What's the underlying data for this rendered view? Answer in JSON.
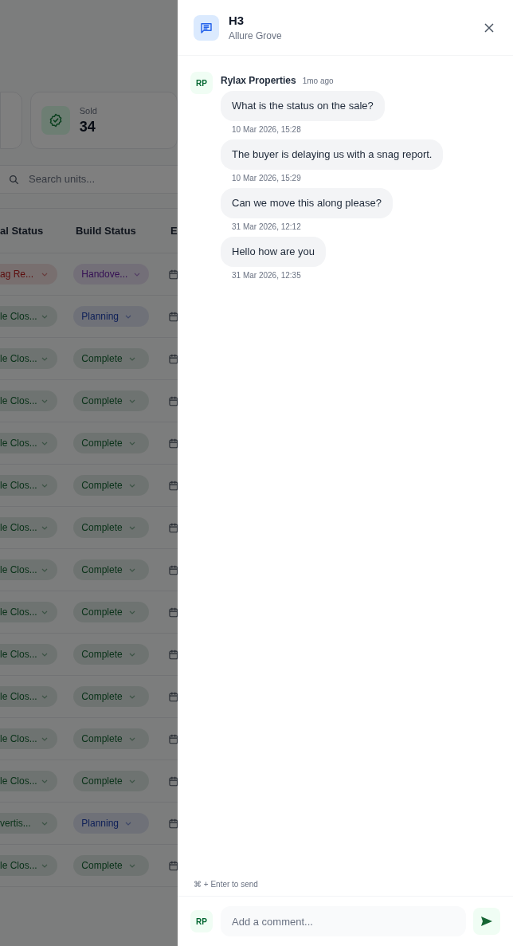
{
  "background": {
    "stat_card": {
      "label": "Sold",
      "value": "34"
    },
    "search": {
      "placeholder": "Search units..."
    },
    "table": {
      "columns": [
        "al Status",
        "Build Status",
        "E"
      ],
      "rows": [
        {
          "sales_status": {
            "text": "ag Re...",
            "kind": "red"
          },
          "build_status": {
            "text": "Handove...",
            "kind": "purple"
          }
        },
        {
          "sales_status": {
            "text": "le Clos...",
            "kind": "green"
          },
          "build_status": {
            "text": "Planning",
            "kind": "blue"
          }
        },
        {
          "sales_status": {
            "text": "le Clos...",
            "kind": "green"
          },
          "build_status": {
            "text": "Complete",
            "kind": "green"
          }
        },
        {
          "sales_status": {
            "text": "le Clos...",
            "kind": "green"
          },
          "build_status": {
            "text": "Complete",
            "kind": "green"
          }
        },
        {
          "sales_status": {
            "text": "le Clos...",
            "kind": "green"
          },
          "build_status": {
            "text": "Complete",
            "kind": "green"
          }
        },
        {
          "sales_status": {
            "text": "le Clos...",
            "kind": "green"
          },
          "build_status": {
            "text": "Complete",
            "kind": "green"
          }
        },
        {
          "sales_status": {
            "text": "le Clos...",
            "kind": "green"
          },
          "build_status": {
            "text": "Complete",
            "kind": "green"
          }
        },
        {
          "sales_status": {
            "text": "le Clos...",
            "kind": "green"
          },
          "build_status": {
            "text": "Complete",
            "kind": "green"
          }
        },
        {
          "sales_status": {
            "text": "le Clos...",
            "kind": "green"
          },
          "build_status": {
            "text": "Complete",
            "kind": "green"
          }
        },
        {
          "sales_status": {
            "text": "le Clos...",
            "kind": "green"
          },
          "build_status": {
            "text": "Complete",
            "kind": "green"
          }
        },
        {
          "sales_status": {
            "text": "le Clos...",
            "kind": "green"
          },
          "build_status": {
            "text": "Complete",
            "kind": "green"
          }
        },
        {
          "sales_status": {
            "text": "le Clos...",
            "kind": "green"
          },
          "build_status": {
            "text": "Complete",
            "kind": "green"
          }
        },
        {
          "sales_status": {
            "text": "le Clos...",
            "kind": "green"
          },
          "build_status": {
            "text": "Complete",
            "kind": "green"
          }
        },
        {
          "sales_status": {
            "text": "vertis...",
            "kind": "green"
          },
          "build_status": {
            "text": "Planning",
            "kind": "blue"
          }
        },
        {
          "sales_status": {
            "text": "le Clos...",
            "kind": "green"
          },
          "build_status": {
            "text": "Complete",
            "kind": "green"
          }
        }
      ]
    }
  },
  "panel": {
    "title": "H3",
    "subtitle": "Allure Grove",
    "thread": {
      "initials": "RP",
      "author": "Rylax Properties",
      "time_ago": "1mo ago",
      "messages": [
        {
          "text": "What is the status on the sale?",
          "timestamp": "10 Mar 2026, 15:28"
        },
        {
          "text": "The buyer is delaying us with a snag report.",
          "timestamp": "10 Mar 2026, 15:29"
        },
        {
          "text": "Can we move this along please?",
          "timestamp": "31 Mar 2026, 12:12"
        },
        {
          "text": "Hello how are you",
          "timestamp": "31 Mar 2026, 12:35"
        }
      ]
    },
    "hint": "⌘ + Enter to send",
    "composer": {
      "initials": "RP",
      "placeholder": "Add a comment..."
    }
  }
}
